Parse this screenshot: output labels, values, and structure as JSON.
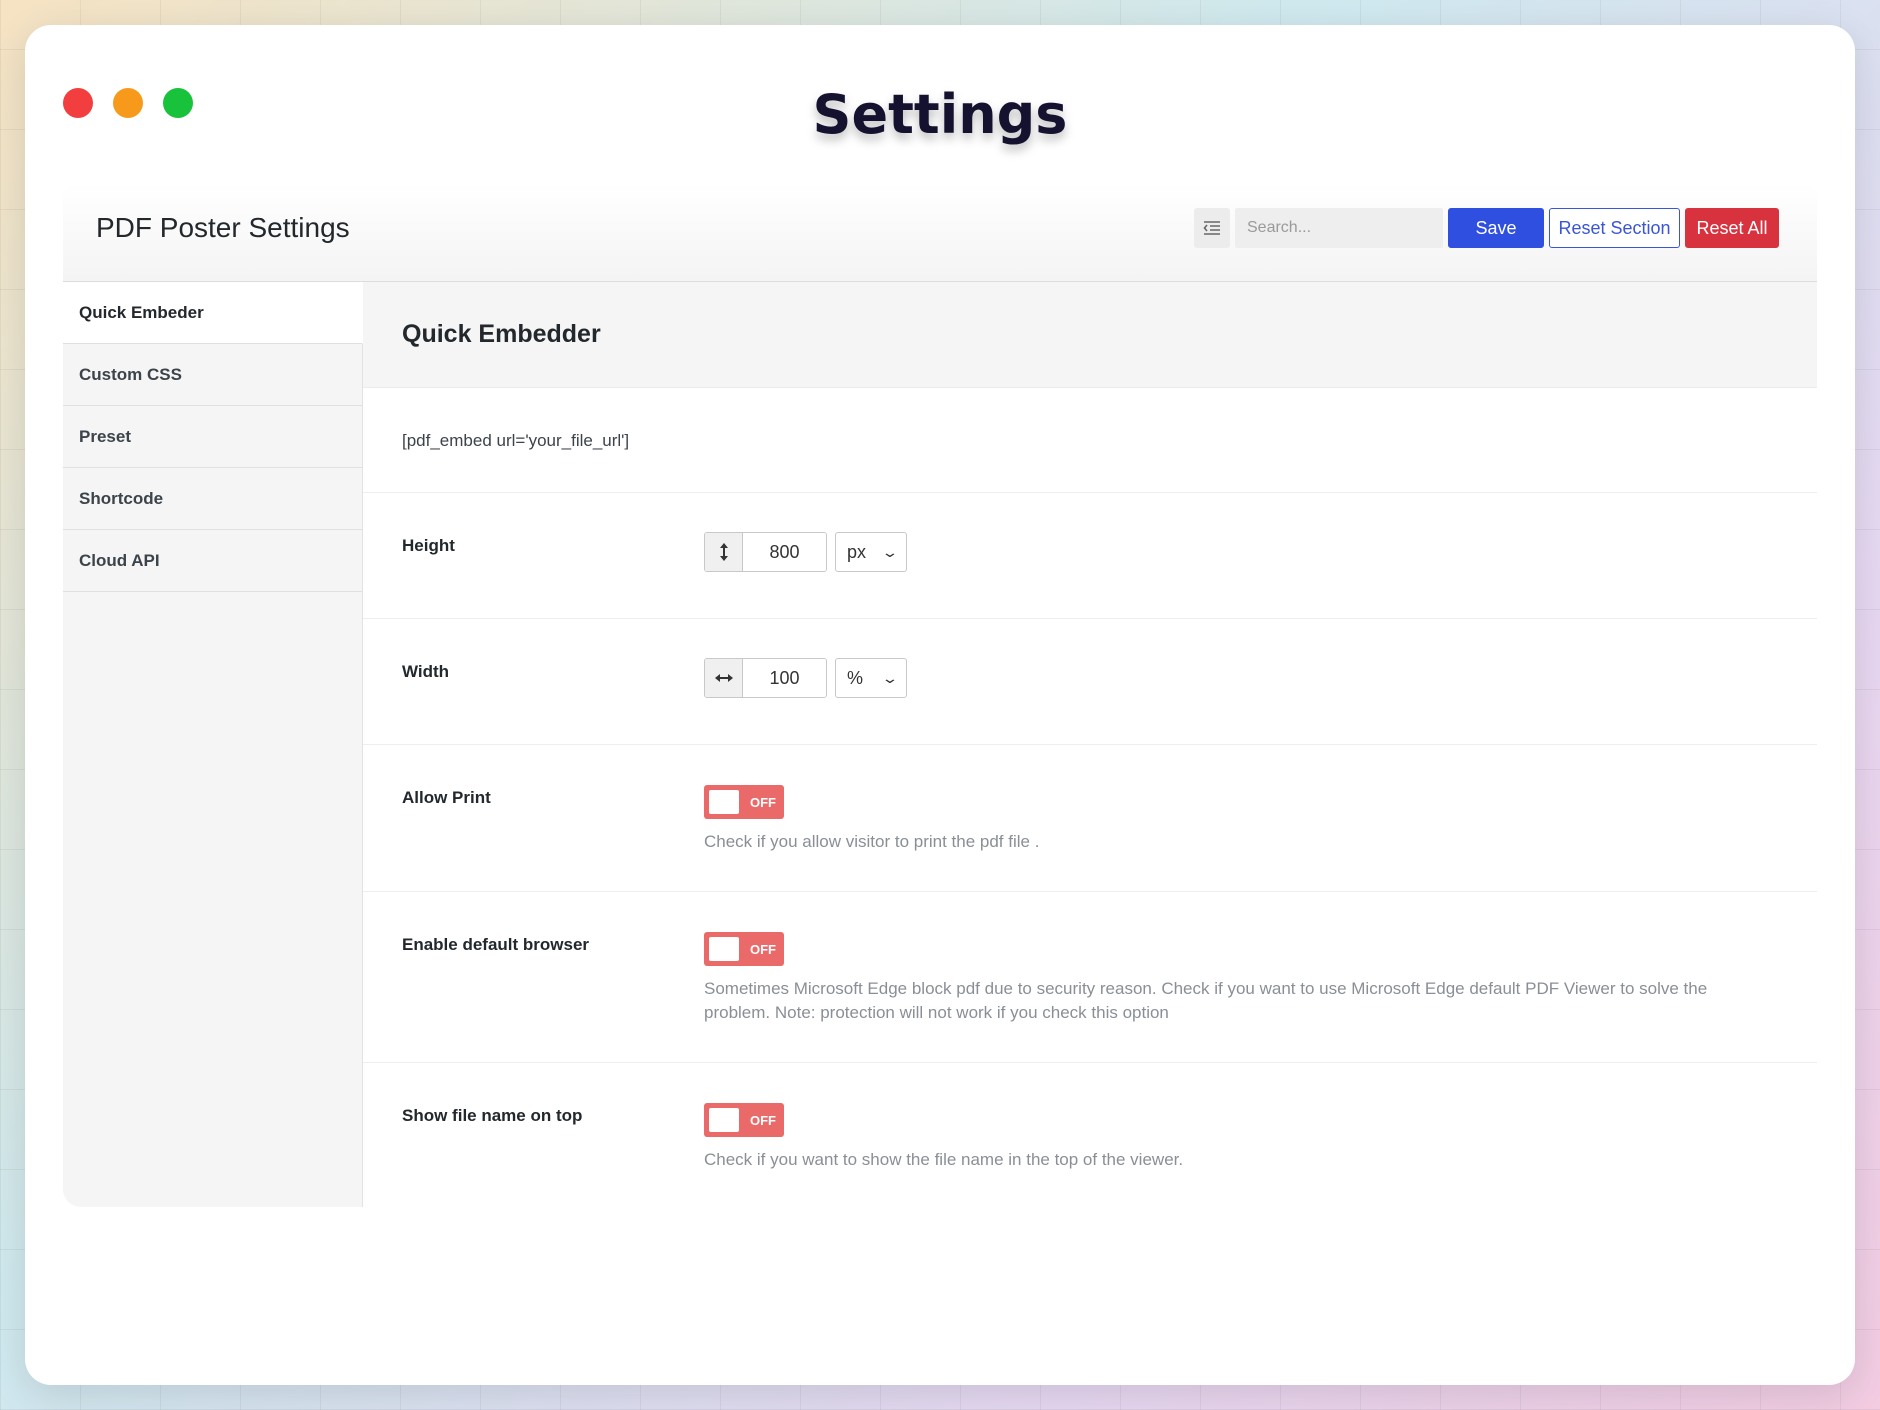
{
  "window": {
    "title": "Settings",
    "controls": {
      "close_color": "#f23e3e",
      "minimize_color": "#f79a1b",
      "maximize_color": "#19c23b"
    }
  },
  "header": {
    "title": "PDF Poster Settings",
    "toc_icon": "list-indent-icon",
    "search_placeholder": "Search...",
    "search_value": "",
    "save_label": "Save",
    "reset_section_label": "Reset Section",
    "reset_all_label": "Reset All"
  },
  "sidebar": {
    "items": [
      {
        "label": "Quick Embeder",
        "active": true
      },
      {
        "label": "Custom CSS",
        "active": false
      },
      {
        "label": "Preset",
        "active": false
      },
      {
        "label": "Shortcode",
        "active": false
      },
      {
        "label": "Cloud API",
        "active": false
      }
    ]
  },
  "main": {
    "section_title": "Quick Embedder",
    "shortcode": "[pdf_embed url='your_file_url']",
    "height": {
      "label": "Height",
      "value": "800",
      "unit": "px",
      "icon": "vertical-arrows-icon"
    },
    "width": {
      "label": "Width",
      "value": "100",
      "unit": "%",
      "icon": "horizontal-arrows-icon"
    },
    "allow_print": {
      "label": "Allow Print",
      "state": "OFF",
      "description": "Check if you allow visitor to print the pdf file ."
    },
    "default_browser": {
      "label": "Enable default browser",
      "state": "OFF",
      "description": "Sometimes Microsoft Edge block pdf due to security reason. Check if you want to use Microsoft Edge default PDF Viewer to solve the problem. Note: protection will not work if you check this option"
    },
    "show_file_name": {
      "label": "Show file name on top",
      "state": "OFF",
      "description": "Check if you want to show the file name in the top of the viewer."
    }
  },
  "colors": {
    "save": "#2f4fe0",
    "reset_section": "#3a55d6",
    "reset_all": "#d8323f",
    "toggle_off": "#ea6a6a"
  }
}
